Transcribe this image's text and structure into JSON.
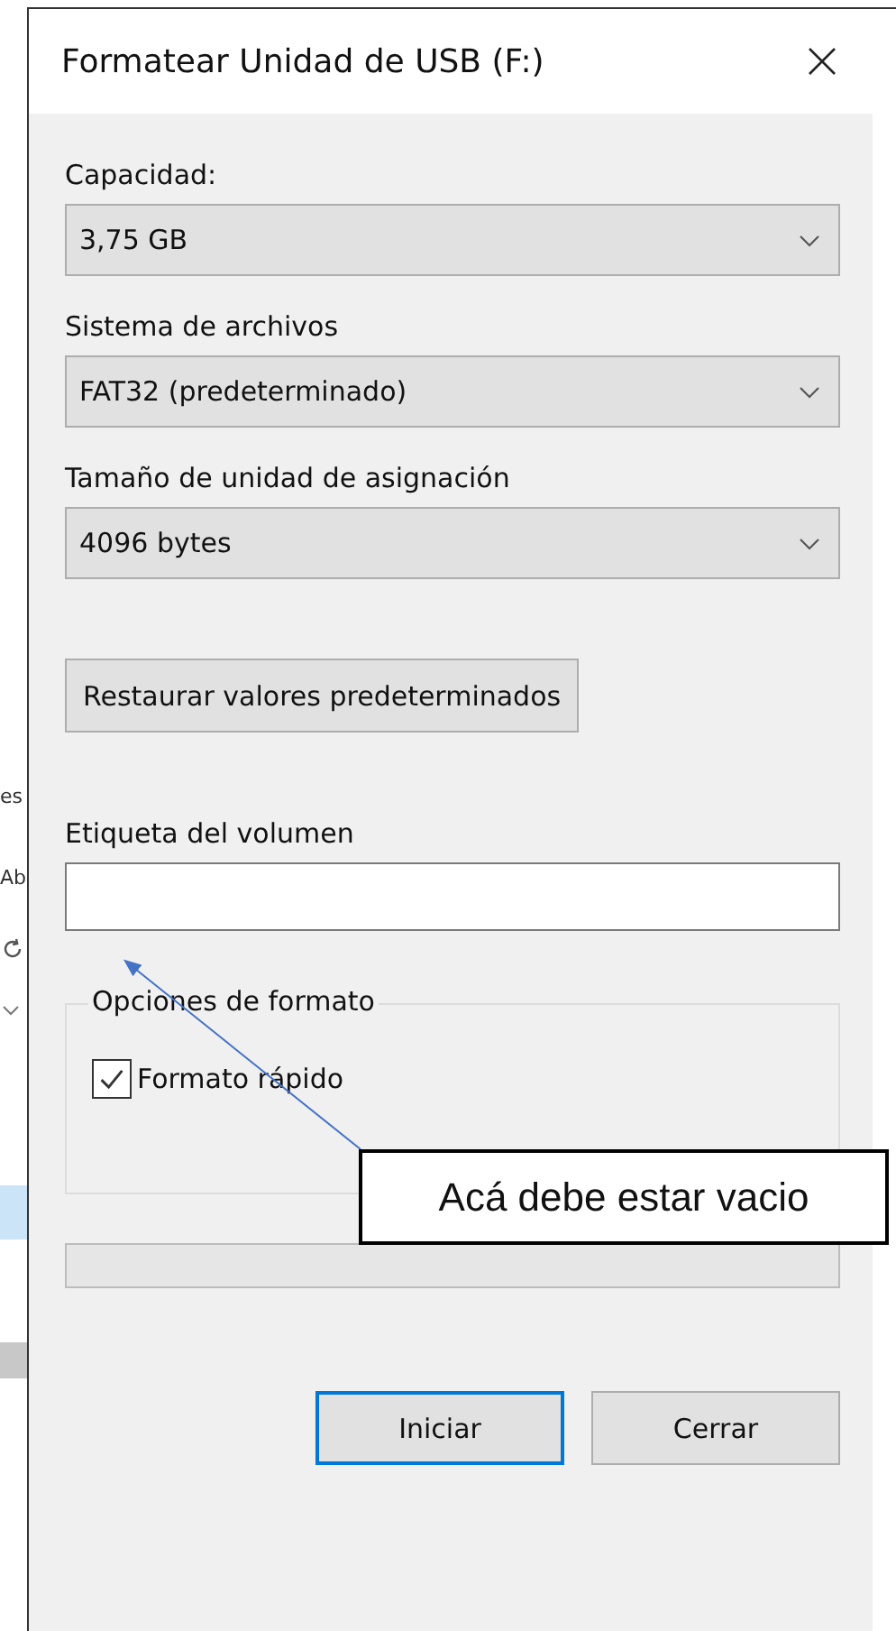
{
  "background_window": {
    "texts": [
      "es",
      "Ab"
    ]
  },
  "window": {
    "title": "Formatear Unidad de USB (F:)"
  },
  "fields": [
    {
      "label": "Capacidad:",
      "value": "3,75 GB"
    },
    {
      "label": "Sistema de archivos",
      "value": "FAT32 (predeterminado)"
    },
    {
      "label": "Tamaño de unidad de asignación",
      "value": "4096 bytes"
    }
  ],
  "restore_button": "Restaurar valores predeterminados",
  "volume_label": {
    "label": "Etiqueta del volumen"
  },
  "format_options": {
    "title": "Opciones de formato",
    "options": [
      {
        "label": "Formato rápido",
        "checked": true
      }
    ]
  },
  "progress": {
    "level": 0
  },
  "buttons": [
    {
      "label": "Iniciar",
      "focused": true
    },
    {
      "label": "Cerrar",
      "focused": false
    }
  ],
  "annotation": {
    "text": "Acá debe estar vacio"
  }
}
